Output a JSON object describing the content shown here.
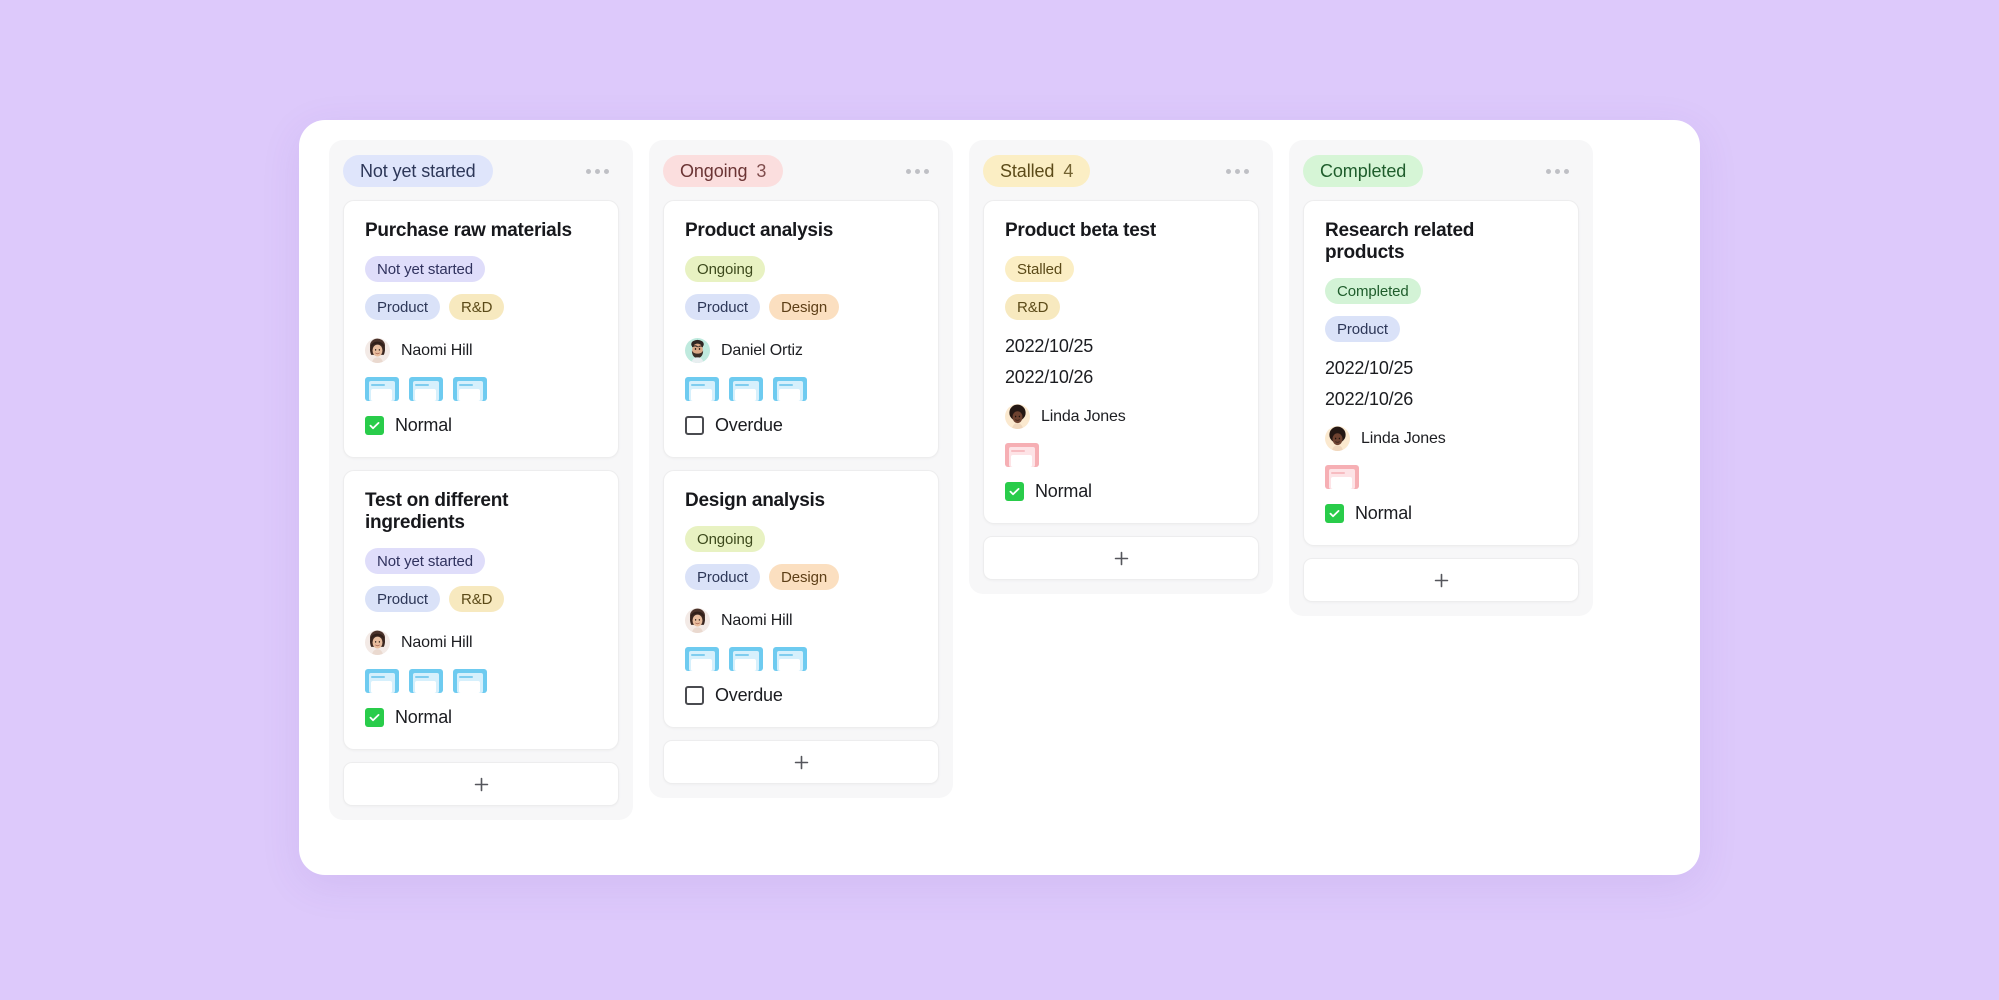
{
  "board": {
    "background_color": "#ddc9fb",
    "surface_color": "#ffffff"
  },
  "columns": [
    {
      "id": "not-yet-started",
      "chip_label": "Not yet started",
      "count": "",
      "chip_class": "chip-notyet",
      "menu_icon": "more-horizontal-icon",
      "add_label": "+",
      "cards": [
        {
          "title": "Purchase raw materials",
          "status_tag": {
            "label": "Not yet started",
            "class": "t-notyet"
          },
          "tags": [
            {
              "label": "Product",
              "class": "t-product"
            },
            {
              "label": "R&D",
              "class": "t-rd"
            }
          ],
          "dates": [],
          "person": {
            "name": "Naomi Hill",
            "avatar": "woman-dark-hair"
          },
          "attachments": [
            {
              "color": "blue"
            },
            {
              "color": "blue"
            },
            {
              "color": "blue"
            }
          ],
          "check": {
            "label": "Normal",
            "checked": true
          }
        },
        {
          "title": "Test on different ingredients",
          "status_tag": {
            "label": "Not yet started",
            "class": "t-notyet"
          },
          "tags": [
            {
              "label": "Product",
              "class": "t-product"
            },
            {
              "label": "R&D",
              "class": "t-rd"
            }
          ],
          "dates": [],
          "person": {
            "name": "Naomi Hill",
            "avatar": "woman-dark-hair"
          },
          "attachments": [
            {
              "color": "blue"
            },
            {
              "color": "blue"
            },
            {
              "color": "blue"
            }
          ],
          "check": {
            "label": "Normal",
            "checked": true
          }
        }
      ]
    },
    {
      "id": "ongoing",
      "chip_label": "Ongoing",
      "count": "3",
      "chip_class": "chip-ongoing",
      "menu_icon": "more-horizontal-icon",
      "add_label": "+",
      "cards": [
        {
          "title": "Product analysis",
          "status_tag": {
            "label": "Ongoing",
            "class": "t-ongoing"
          },
          "tags": [
            {
              "label": "Product",
              "class": "t-product"
            },
            {
              "label": "Design",
              "class": "t-design"
            }
          ],
          "dates": [],
          "person": {
            "name": "Daniel Ortiz",
            "avatar": "man-beard"
          },
          "attachments": [
            {
              "color": "blue"
            },
            {
              "color": "blue"
            },
            {
              "color": "blue"
            }
          ],
          "check": {
            "label": "Overdue",
            "checked": false
          }
        },
        {
          "title": "Design analysis",
          "status_tag": {
            "label": "Ongoing",
            "class": "t-ongoing"
          },
          "tags": [
            {
              "label": "Product",
              "class": "t-product"
            },
            {
              "label": "Design",
              "class": "t-design"
            }
          ],
          "dates": [],
          "person": {
            "name": "Naomi Hill",
            "avatar": "woman-dark-hair"
          },
          "attachments": [
            {
              "color": "blue"
            },
            {
              "color": "blue"
            },
            {
              "color": "blue"
            }
          ],
          "check": {
            "label": "Overdue",
            "checked": false
          }
        }
      ]
    },
    {
      "id": "stalled",
      "chip_label": "Stalled",
      "count": "4",
      "chip_class": "chip-stalled",
      "menu_icon": "more-horizontal-icon",
      "add_label": "+",
      "cards": [
        {
          "title": "Product beta test",
          "status_tag": {
            "label": "Stalled",
            "class": "t-stalled"
          },
          "tags": [
            {
              "label": "R&D",
              "class": "t-rd"
            }
          ],
          "dates": [
            "2022/10/25",
            "2022/10/26"
          ],
          "person": {
            "name": "Linda Jones",
            "avatar": "woman-afro"
          },
          "attachments": [
            {
              "color": "pink"
            }
          ],
          "check": {
            "label": "Normal",
            "checked": true
          }
        }
      ]
    },
    {
      "id": "completed",
      "chip_label": "Completed",
      "count": "",
      "chip_class": "chip-completed",
      "menu_icon": "more-horizontal-icon",
      "add_label": "+",
      "cards": [
        {
          "title": "Research related products",
          "status_tag": {
            "label": "Completed",
            "class": "t-completed"
          },
          "tags": [
            {
              "label": "Product",
              "class": "t-product"
            }
          ],
          "dates": [
            "2022/10/25",
            "2022/10/26"
          ],
          "person": {
            "name": "Linda Jones",
            "avatar": "woman-afro"
          },
          "attachments": [
            {
              "color": "pink"
            }
          ],
          "check": {
            "label": "Normal",
            "checked": true
          }
        }
      ]
    }
  ]
}
